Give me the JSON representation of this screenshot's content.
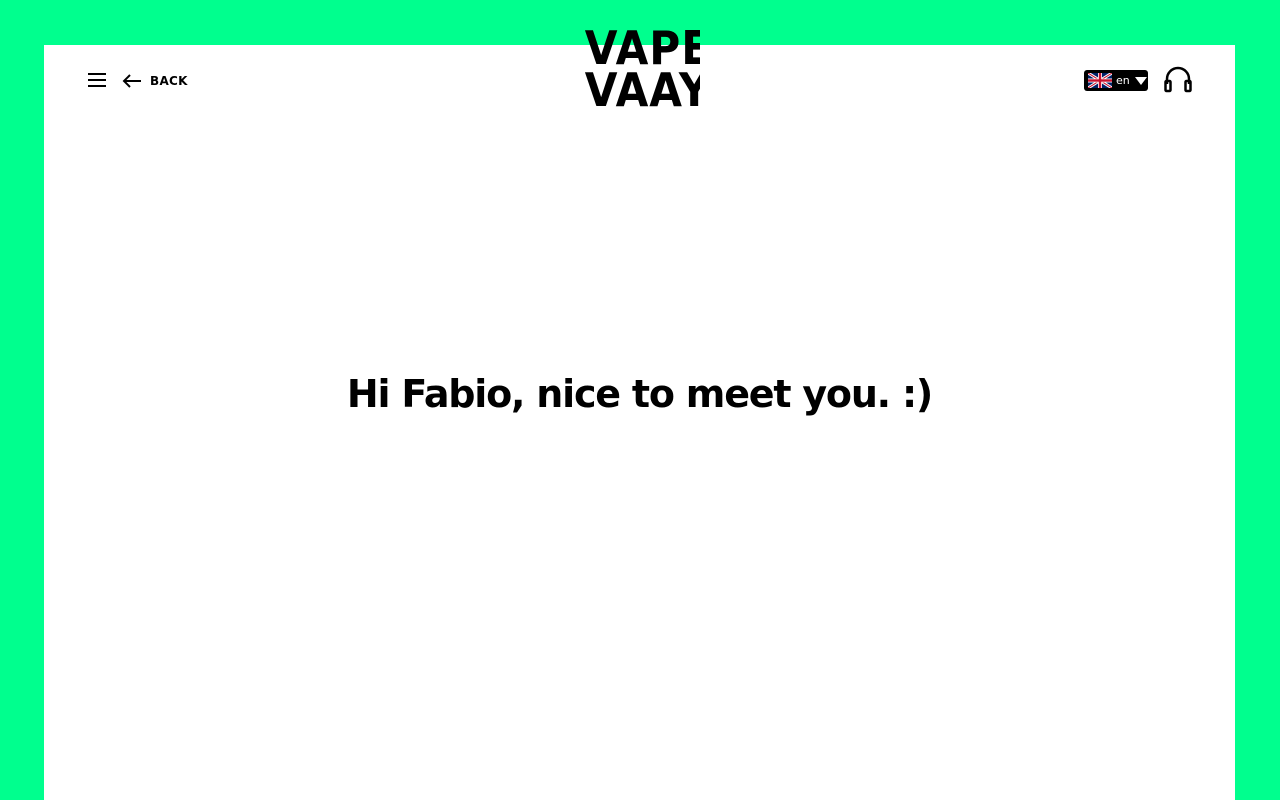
{
  "colors": {
    "background": "#00ff8e",
    "panel": "#ffffff",
    "text": "#000000"
  },
  "header": {
    "menu_icon": "hamburger-menu-icon",
    "back_icon": "arrow-left-icon",
    "back_label": "BACK",
    "logo": {
      "line1": "VAPE",
      "line2": "VAAY"
    },
    "language": {
      "flag_icon": "uk-flag-icon",
      "selected": "en",
      "caret_icon": "chevron-down-icon"
    },
    "audio_icon": "headphones-icon"
  },
  "main": {
    "greeting": "Hi Fabio, nice to meet you. :)"
  }
}
